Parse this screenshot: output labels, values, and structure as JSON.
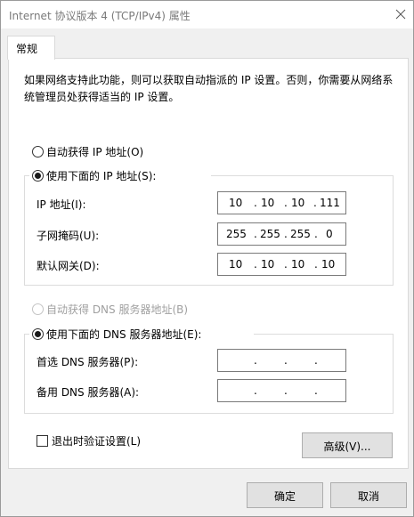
{
  "window": {
    "title": "Internet 协议版本 4 (TCP/IPv4) 属性",
    "close_icon": "close-icon"
  },
  "tabs": [
    {
      "label": "常规",
      "selected": true
    }
  ],
  "description": "如果网络支持此功能，则可以获取自动指派的 IP 设置。否则，你需要从网络系统管理员处获得适当的 IP 设置。",
  "ip_section": {
    "auto_ip_label": "自动获得 IP 地址(O)",
    "auto_ip_checked": false,
    "manual_ip_label": "使用下面的 IP 地址(S):",
    "manual_ip_checked": true,
    "fields": [
      {
        "label": "IP 地址(I):",
        "octets": [
          "10",
          "10",
          "10",
          "111"
        ]
      },
      {
        "label": "子网掩码(U):",
        "octets": [
          "255",
          "255",
          "255",
          "0"
        ]
      },
      {
        "label": "默认网关(D):",
        "octets": [
          "10",
          "10",
          "10",
          "10"
        ]
      }
    ]
  },
  "dns_section": {
    "auto_dns_label": "自动获得 DNS 服务器地址(B)",
    "auto_dns_checked": false,
    "auto_dns_disabled": true,
    "manual_dns_label": "使用下面的 DNS 服务器地址(E):",
    "manual_dns_checked": true,
    "fields": [
      {
        "label": "首选 DNS 服务器(P):",
        "octets": [
          "",
          "",
          "",
          ""
        ]
      },
      {
        "label": "备用 DNS 服务器(A):",
        "octets": [
          "",
          "",
          "",
          ""
        ]
      }
    ]
  },
  "validate_on_exit": {
    "label": "退出时验证设置(L)",
    "checked": false
  },
  "buttons": {
    "advanced": "高级(V)...",
    "ok": "确定",
    "cancel": "取消"
  },
  "ip_separator": "."
}
